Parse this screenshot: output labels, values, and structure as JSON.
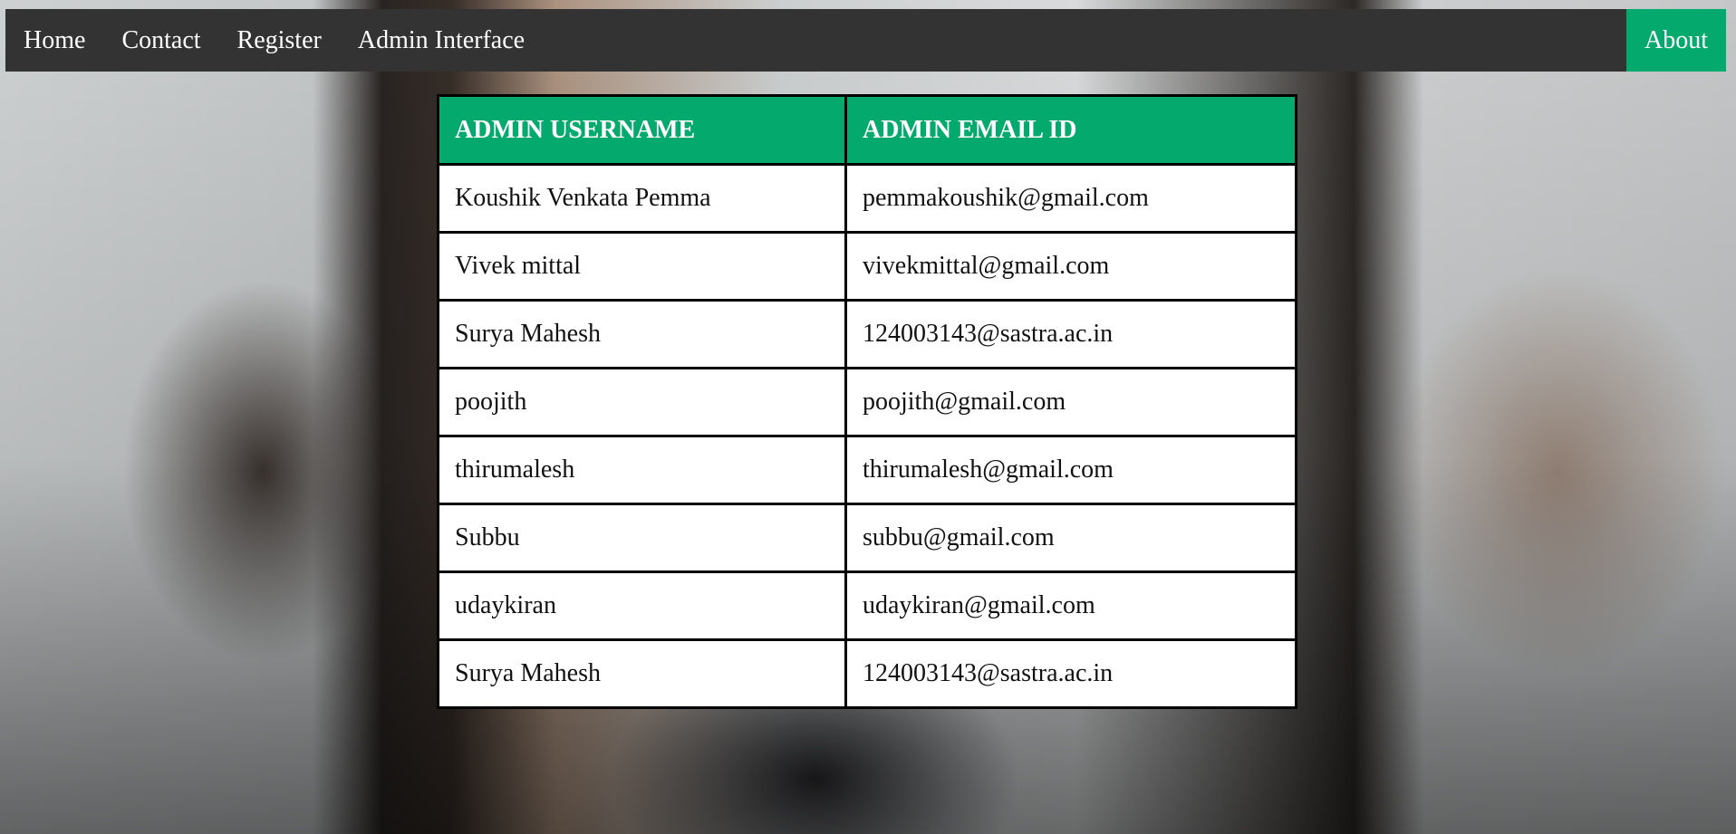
{
  "nav": {
    "items": [
      "Home",
      "Contact",
      "Register",
      "Admin Interface"
    ],
    "about": "About",
    "active_color": "#04AA6D",
    "bar_color": "#333333"
  },
  "table": {
    "headers": [
      "ADMIN USERNAME",
      "ADMIN EMAIL ID"
    ],
    "rows": [
      [
        "Koushik Venkata Pemma",
        "pemmakoushik@gmail.com"
      ],
      [
        "Vivek mittal",
        "vivekmittal@gmail.com"
      ],
      [
        "Surya Mahesh",
        "124003143@sastra.ac.in"
      ],
      [
        "poojith",
        "poojith@gmail.com"
      ],
      [
        "thirumalesh",
        "thirumalesh@gmail.com"
      ],
      [
        "Subbu",
        "subbu@gmail.com"
      ],
      [
        "udaykiran",
        "udaykiran@gmail.com"
      ],
      [
        "Surya Mahesh",
        "124003143@sastra.ac.in"
      ]
    ]
  }
}
